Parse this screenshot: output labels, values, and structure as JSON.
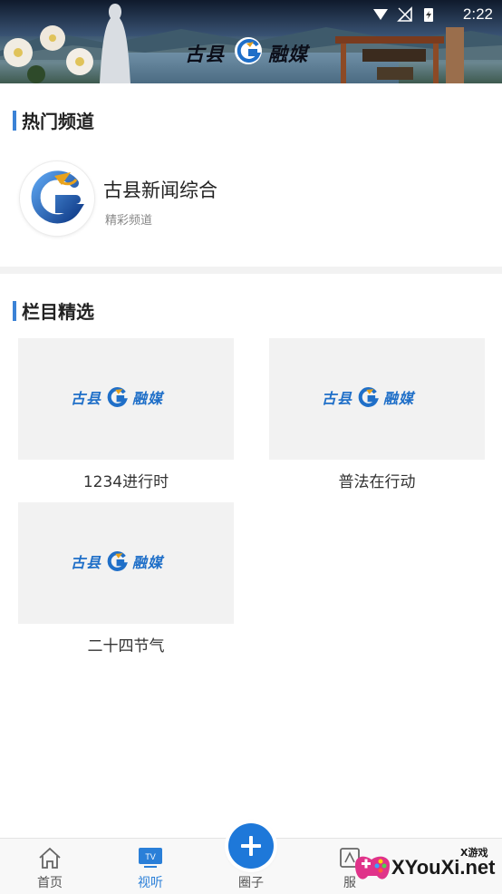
{
  "status_bar": {
    "time": "2:22"
  },
  "banner": {
    "logo_left": "古县",
    "logo_right": "融媒"
  },
  "hot_channels": {
    "title": "热门频道",
    "channel": {
      "name": "古县新闻综合",
      "subtitle": "精彩频道"
    }
  },
  "featured": {
    "title": "栏目精选",
    "thumb_logo_left": "古县",
    "thumb_logo_right": "融媒",
    "items": [
      {
        "label": "1234进行时"
      },
      {
        "label": "普法在行动"
      },
      {
        "label": "二十四节气"
      }
    ]
  },
  "bottom_nav": {
    "items": [
      {
        "label": "首页",
        "icon": "home-icon"
      },
      {
        "label": "视听",
        "icon": "tv-icon"
      },
      {
        "label": "圈子",
        "icon": "plus-icon"
      },
      {
        "label": "服",
        "icon": "service-icon"
      }
    ],
    "tv_badge": "TV"
  },
  "watermark": {
    "main": "XYouXi.net",
    "top": "X游戏"
  },
  "colors": {
    "accent": "#1e78d9",
    "section_bar": "#3b82d6",
    "active_tab": "#2a7fd8"
  }
}
